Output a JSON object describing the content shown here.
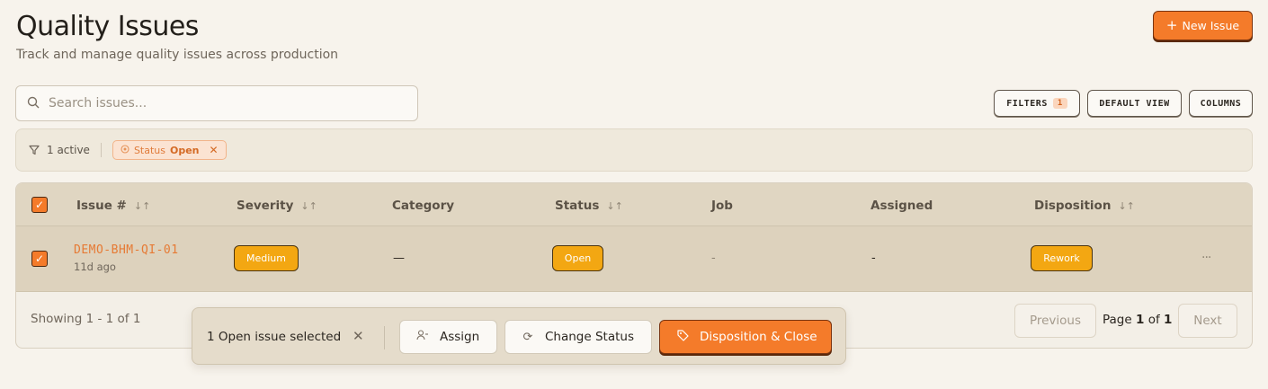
{
  "header": {
    "title": "Quality Issues",
    "subtitle": "Track and manage quality issues across production",
    "new_button": "New Issue"
  },
  "search": {
    "placeholder": "Search issues..."
  },
  "toolbar": {
    "filters_label": "FILTERS",
    "filters_count": "1",
    "default_view_label": "DEFAULT VIEW",
    "columns_label": "COLUMNS"
  },
  "filter_bar": {
    "active_label": "1 active",
    "chip_field": "Status",
    "chip_value": "Open"
  },
  "table": {
    "columns": [
      "Issue #",
      "Severity",
      "Category",
      "Status",
      "Job",
      "Assigned",
      "Disposition"
    ],
    "rows": [
      {
        "issue_id": "DEMO-BHM-QI-01",
        "age": "11d ago",
        "severity": "Medium",
        "category": "—",
        "status": "Open",
        "job": "-",
        "assigned": "-",
        "disposition": "Rework",
        "more": "···"
      }
    ]
  },
  "footer": {
    "showing": "Showing 1 - 1 of 1",
    "previous": "Previous",
    "page_label": "Page",
    "page_current": "1",
    "page_of": "of",
    "page_total": "1",
    "next": "Next"
  },
  "selection_bar": {
    "text": "1 Open issue selected",
    "assign": "Assign",
    "change_status": "Change Status",
    "disposition_close": "Disposition & Close"
  },
  "colors": {
    "accent": "#f47b2a",
    "badge_amber": "#f3a712",
    "background": "#f7f3ec"
  }
}
